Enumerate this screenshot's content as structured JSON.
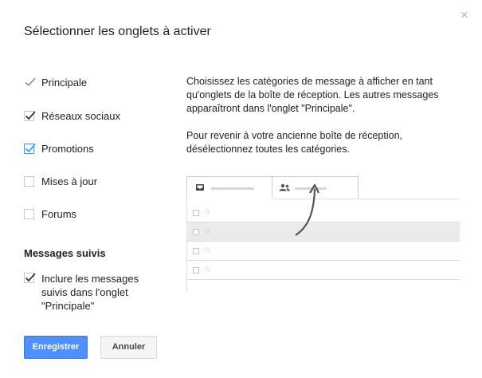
{
  "dialog": {
    "title": "Sélectionner les onglets à activer",
    "close_symbol": "×"
  },
  "tabs": [
    {
      "label": "Principale",
      "state": "checked-disabled"
    },
    {
      "label": "Réseaux sociaux",
      "state": "checked"
    },
    {
      "label": "Promotions",
      "state": "checked-blue"
    },
    {
      "label": "Mises à jour",
      "state": "unchecked"
    },
    {
      "label": "Forums",
      "state": "unchecked"
    }
  ],
  "starred": {
    "section_title": "Messages suivis",
    "option_label": "Inclure les messages suivis dans l'onglet \"Principale\"",
    "state": "checked"
  },
  "description": {
    "paragraph1": "Choisissez les catégories de message à afficher en tant qu'onglets de la boîte de réception. Les autres messages apparaîtront dans l'onglet \"Principale\".",
    "paragraph2": "Pour revenir à votre ancienne boîte de réception, désélectionnez toutes les catégories."
  },
  "preview": {
    "tab_icons": [
      "inbox-icon",
      "people-icon"
    ],
    "rows": 4,
    "selected_row": 2,
    "star_symbol": "☆"
  },
  "buttons": {
    "save_label": "Enregistrer",
    "cancel_label": "Annuler"
  },
  "colors": {
    "primary_button": "#4d90fe",
    "check_blue": "#4d90fe",
    "check_dark": "#333333",
    "check_disabled": "#888888"
  }
}
